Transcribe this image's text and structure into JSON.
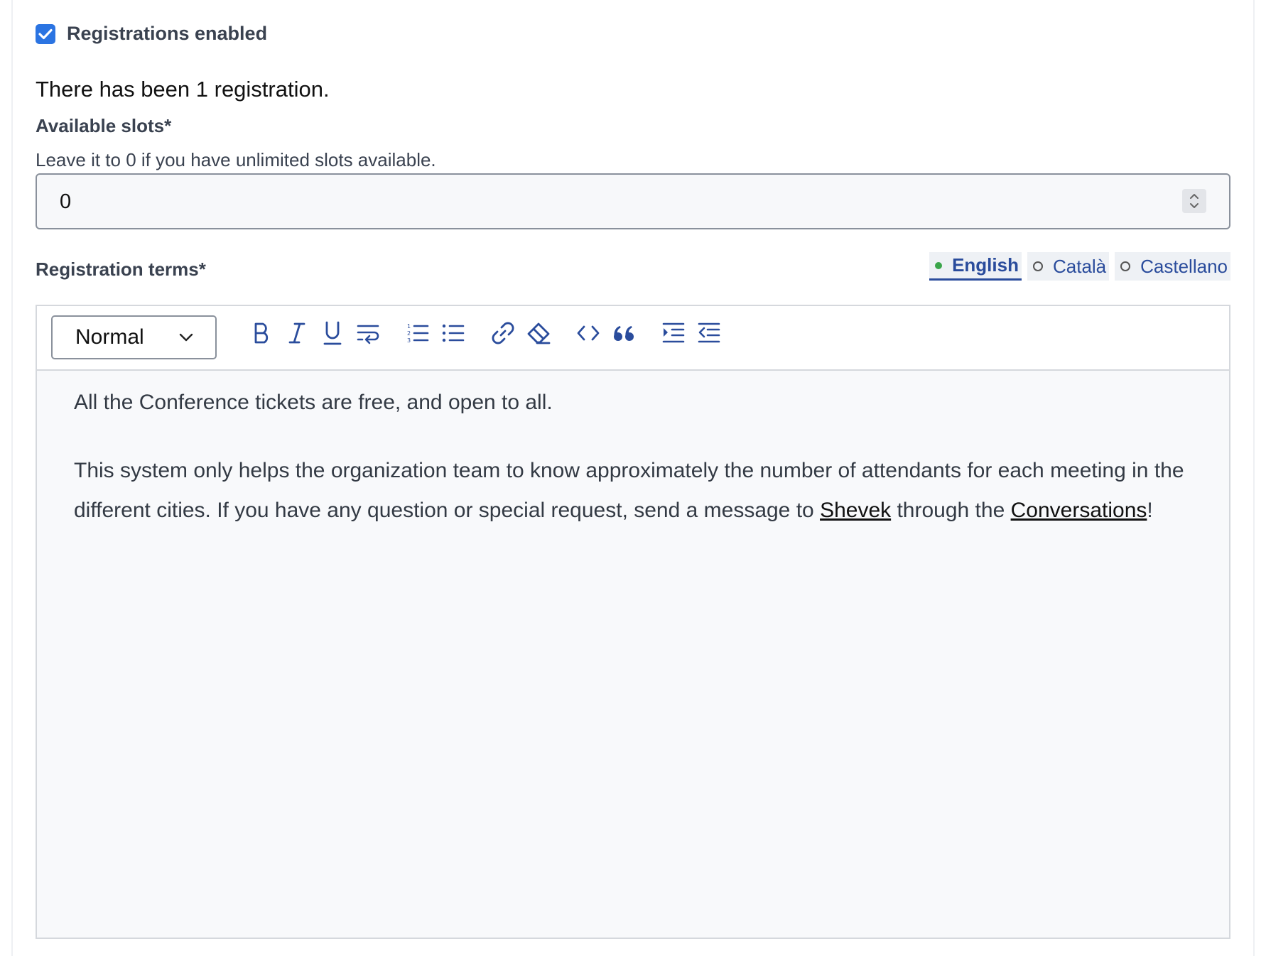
{
  "registrations": {
    "enabled_label": "Registrations enabled",
    "count_text": "There has been 1 registration."
  },
  "slots": {
    "label": "Available slots*",
    "help": "Leave it to 0 if you have unlimited slots available.",
    "value": "0"
  },
  "terms": {
    "label": "Registration terms*",
    "languages": [
      {
        "label": "English",
        "active": true
      },
      {
        "label": "Català",
        "active": false
      },
      {
        "label": "Castellano",
        "active": false
      }
    ]
  },
  "toolbar": {
    "format_value": "Normal",
    "buttons": [
      "bold-icon",
      "italic-icon",
      "underline-icon",
      "hard-break-icon",
      "ordered-list-icon",
      "bullet-list-icon",
      "link-icon",
      "clear-format-icon",
      "code-icon",
      "blockquote-icon",
      "indent-icon",
      "outdent-icon"
    ]
  },
  "editor": {
    "p1": "All the Conference tickets are free, and open to all.",
    "p2_a": "This system only helps the organization team to know approximately the number of attendants for each meeting in the different cities. If you have any question or special request, send a message to ",
    "link1": "Shevek",
    "p2_b": " through the ",
    "link2": "Conversations",
    "p2_c": "!"
  },
  "colors": {
    "accent": "#2a4c9c",
    "checkbox": "#2b74e2",
    "active_dot": "#3aa54a"
  }
}
